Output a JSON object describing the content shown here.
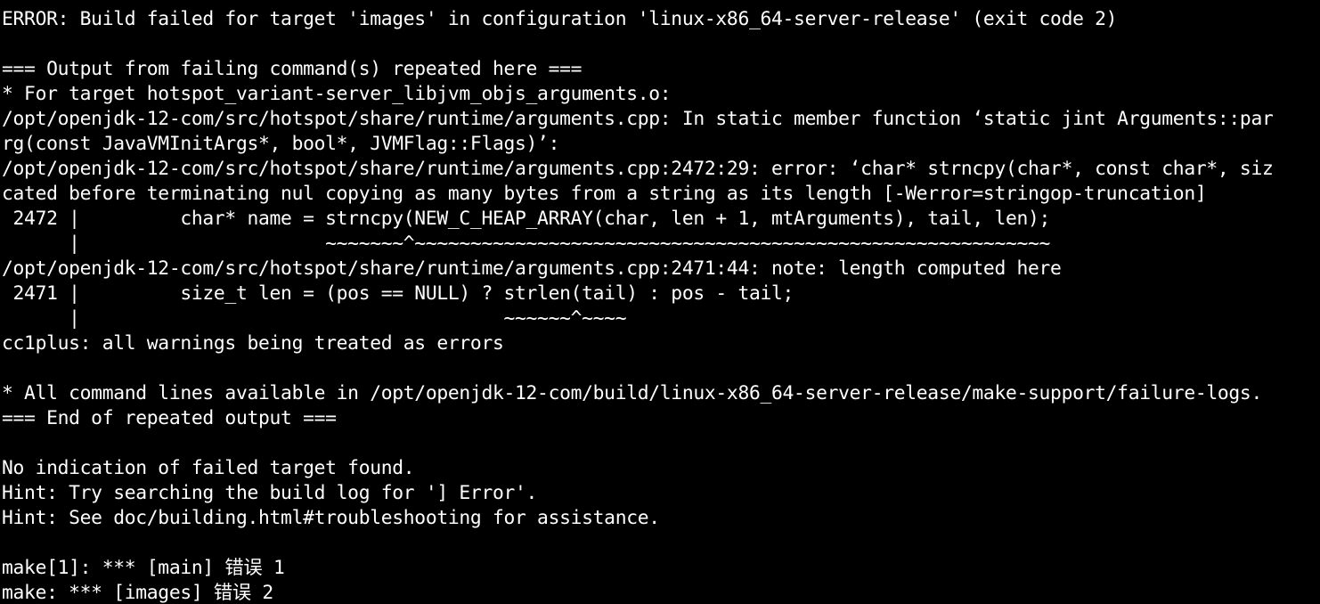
{
  "terminal": {
    "lines": [
      "ERROR: Build failed for target 'images' in configuration 'linux-x86_64-server-release' (exit code 2)",
      "",
      "=== Output from failing command(s) repeated here ===",
      "* For target hotspot_variant-server_libjvm_objs_arguments.o:",
      "/opt/openjdk-12-com/src/hotspot/share/runtime/arguments.cpp: In static member function ‘static jint Arguments::par",
      "rg(const JavaVMInitArgs*, bool*, JVMFlag::Flags)’:",
      "/opt/openjdk-12-com/src/hotspot/share/runtime/arguments.cpp:2472:29: error: ‘char* strncpy(char*, const char*, siz",
      "cated before terminating nul copying as many bytes from a string as its length [-Werror=stringop-truncation]",
      " 2472 |         char* name = strncpy(NEW_C_HEAP_ARRAY(char, len + 1, mtArguments), tail, len);",
      "      |                      ~~~~~~~^~~~~~~~~~~~~~~~~~~~~~~~~~~~~~~~~~~~~~~~~~~~~~~~~~~~~~~~~~",
      "/opt/openjdk-12-com/src/hotspot/share/runtime/arguments.cpp:2471:44: note: length computed here",
      " 2471 |         size_t len = (pos == NULL) ? strlen(tail) : pos - tail;",
      "      |                                      ~~~~~~^~~~~",
      "cc1plus: all warnings being treated as errors",
      "",
      "* All command lines available in /opt/openjdk-12-com/build/linux-x86_64-server-release/make-support/failure-logs.",
      "=== End of repeated output ===",
      "",
      "No indication of failed target found.",
      "Hint: Try searching the build log for '] Error'.",
      "Hint: See doc/building.html#troubleshooting for assistance.",
      "",
      "make[1]: *** [main] 错误 1",
      "make: *** [images] 错误 2"
    ]
  },
  "colors": {
    "background": "#000000",
    "text": "#ffffff"
  }
}
